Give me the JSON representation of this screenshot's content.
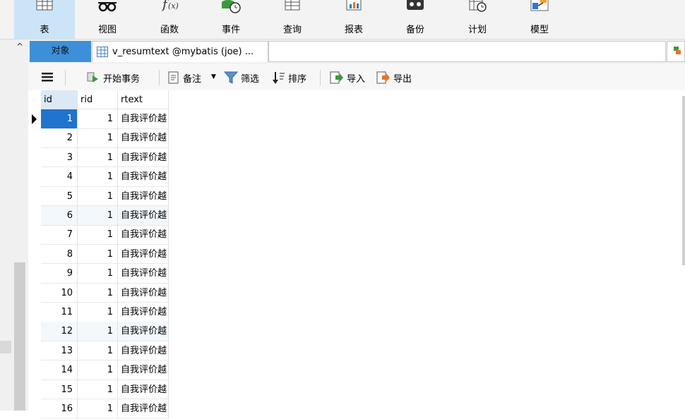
{
  "ribbon": {
    "items": [
      {
        "label": "表",
        "icon": "table-icon",
        "active": true
      },
      {
        "label": "视图",
        "icon": "glasses-icon",
        "active": false
      },
      {
        "label": "函数",
        "icon": "function-icon",
        "active": false
      },
      {
        "label": "事件",
        "icon": "event-icon",
        "active": false
      },
      {
        "label": "查询",
        "icon": "query-icon",
        "active": false
      },
      {
        "label": "报表",
        "icon": "report-icon",
        "active": false
      },
      {
        "label": "备份",
        "icon": "backup-icon",
        "active": false
      },
      {
        "label": "计划",
        "icon": "schedule-icon",
        "active": false
      },
      {
        "label": "模型",
        "icon": "model-icon",
        "active": false
      }
    ]
  },
  "tabs": {
    "collapse": "^",
    "objects_label": "对象",
    "view_tab_label": "v_resumtext @mybatis (joe) ..."
  },
  "toolbar": {
    "begin_transaction": "开始事务",
    "note": "备注",
    "filter": "筛选",
    "sort": "排序",
    "import": "导入",
    "export": "导出"
  },
  "grid": {
    "columns": [
      "id",
      "rid",
      "rtext"
    ],
    "rows": [
      {
        "id": "1",
        "rid": "1",
        "rtext": "自我评价越"
      },
      {
        "id": "2",
        "rid": "1",
        "rtext": "自我评价越"
      },
      {
        "id": "3",
        "rid": "1",
        "rtext": "自我评价越"
      },
      {
        "id": "4",
        "rid": "1",
        "rtext": "自我评价越"
      },
      {
        "id": "5",
        "rid": "1",
        "rtext": "自我评价越"
      },
      {
        "id": "6",
        "rid": "1",
        "rtext": "自我评价越"
      },
      {
        "id": "7",
        "rid": "1",
        "rtext": "自我评价越"
      },
      {
        "id": "8",
        "rid": "1",
        "rtext": "自我评价越"
      },
      {
        "id": "9",
        "rid": "1",
        "rtext": "自我评价越"
      },
      {
        "id": "10",
        "rid": "1",
        "rtext": "自我评价越"
      },
      {
        "id": "11",
        "rid": "1",
        "rtext": "自我评价越"
      },
      {
        "id": "12",
        "rid": "1",
        "rtext": "自我评价越"
      },
      {
        "id": "13",
        "rid": "1",
        "rtext": "自我评价越"
      },
      {
        "id": "14",
        "rid": "1",
        "rtext": "自我评价越"
      },
      {
        "id": "15",
        "rid": "1",
        "rtext": "自我评价越"
      },
      {
        "id": "16",
        "rid": "1",
        "rtext": "自我评价越"
      }
    ],
    "selected_row": 0
  },
  "colors": {
    "ribbon_active": "#cce4f7",
    "objects_tab": "#3d8fd8",
    "selected_cell": "#1f74cf"
  }
}
